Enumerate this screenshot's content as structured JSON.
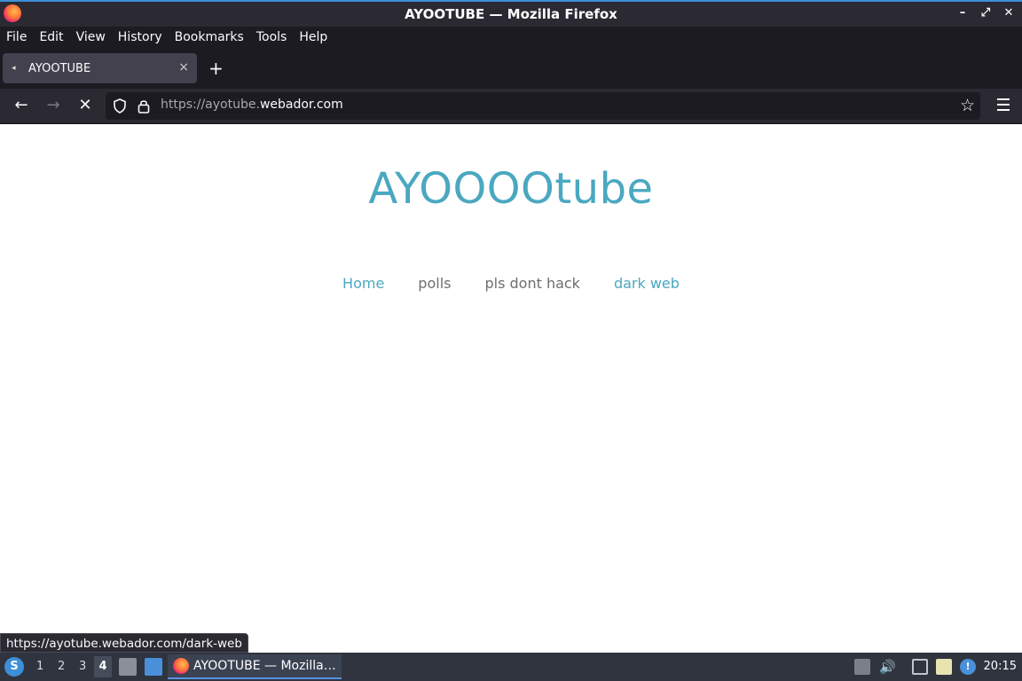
{
  "window": {
    "title": "AYOOTUBE — Mozilla Firefox"
  },
  "menu": {
    "file": "File",
    "edit": "Edit",
    "view": "View",
    "history": "History",
    "bookmarks": "Bookmarks",
    "tools": "Tools",
    "help": "Help"
  },
  "tab": {
    "label": "AYOOTUBE",
    "close": "×"
  },
  "newtab": "+",
  "nav": {
    "back": "←",
    "forward": "→",
    "stop": "✕"
  },
  "url": {
    "scheme": "https://ayotube.",
    "host": "webador.com"
  },
  "bookmark_star": "☆",
  "site": {
    "title": "AYOOOOtube",
    "nav": [
      {
        "label": "Home",
        "active": true
      },
      {
        "label": "polls",
        "active": false
      },
      {
        "label": "pls dont hack",
        "active": false
      },
      {
        "label": "dark web",
        "active": true
      }
    ]
  },
  "status_link": "https://ayotube.webador.com/dark-web",
  "taskbar": {
    "workspaces": [
      "1",
      "2",
      "3",
      "4"
    ],
    "current_workspace": "4",
    "task_label": "AYOOTUBE — Mozilla…",
    "clock": "20:15"
  },
  "colors": {
    "accent": "#4aa8c0",
    "taskbar": "#2f343f",
    "highlight": "#5294e2"
  },
  "icons": [
    "firefox-icon",
    "shield-icon",
    "lock-icon",
    "star-icon",
    "menu-icon",
    "volume-icon",
    "network-icon",
    "clipboard-icon",
    "notification-icon"
  ]
}
